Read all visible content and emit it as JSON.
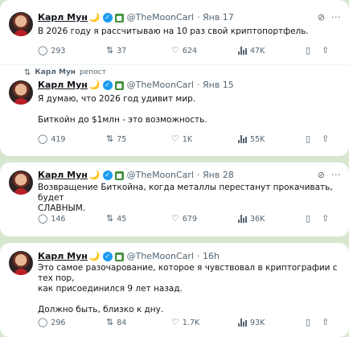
{
  "author": {
    "name": "Карл Мун",
    "moon_emoji": "🌙",
    "handle": "@TheMoonCarl"
  },
  "icons": {
    "reply": "reply-icon",
    "retweet": "retweet-icon",
    "like": "heart-icon",
    "views": "views-bar-icon",
    "bookmark": "bookmark-icon",
    "share": "share-icon",
    "grok": "grok-icon",
    "more": "more-icon"
  },
  "colors": {
    "background": "#d7e6cf",
    "verified": "#1d9bf0",
    "muted": "#536471"
  },
  "tweets": [
    {
      "timestamp": "· Янв 17",
      "lines": [
        "В 2026 году я рассчитываю на 10 раз свой криптопортфель."
      ],
      "stats": {
        "replies": "293",
        "retweets": "37",
        "likes": "624",
        "views": "47K"
      }
    },
    {
      "repost_label": "Карл Мун",
      "repost_suffix": "репост",
      "timestamp": "· Янв 15",
      "lines": [
        "Я думаю, что 2026 год удивит мир.",
        "Биткойн до $1млн - это возможность."
      ],
      "stats": {
        "replies": "419",
        "retweets": "75",
        "likes": "1K",
        "views": "55K"
      }
    },
    {
      "timestamp": "· Янв 28",
      "lines": [
        "Возвращение Биткойна, когда металлы перестанут прокачивать, будет",
        "СЛАВНЫМ."
      ],
      "stats": {
        "replies": "146",
        "retweets": "45",
        "likes": "679",
        "views": "36K"
      }
    },
    {
      "timestamp": "· 16h",
      "lines": [
        "Это самое разочарование, которое я чувствовал в криптографии с тех пор,",
        "как присоединился 9 лет назад.",
        "Должно быть, близко к дну."
      ],
      "stats": {
        "replies": "296",
        "retweets": "84",
        "likes": "1.7K",
        "views": "93K"
      }
    }
  ]
}
